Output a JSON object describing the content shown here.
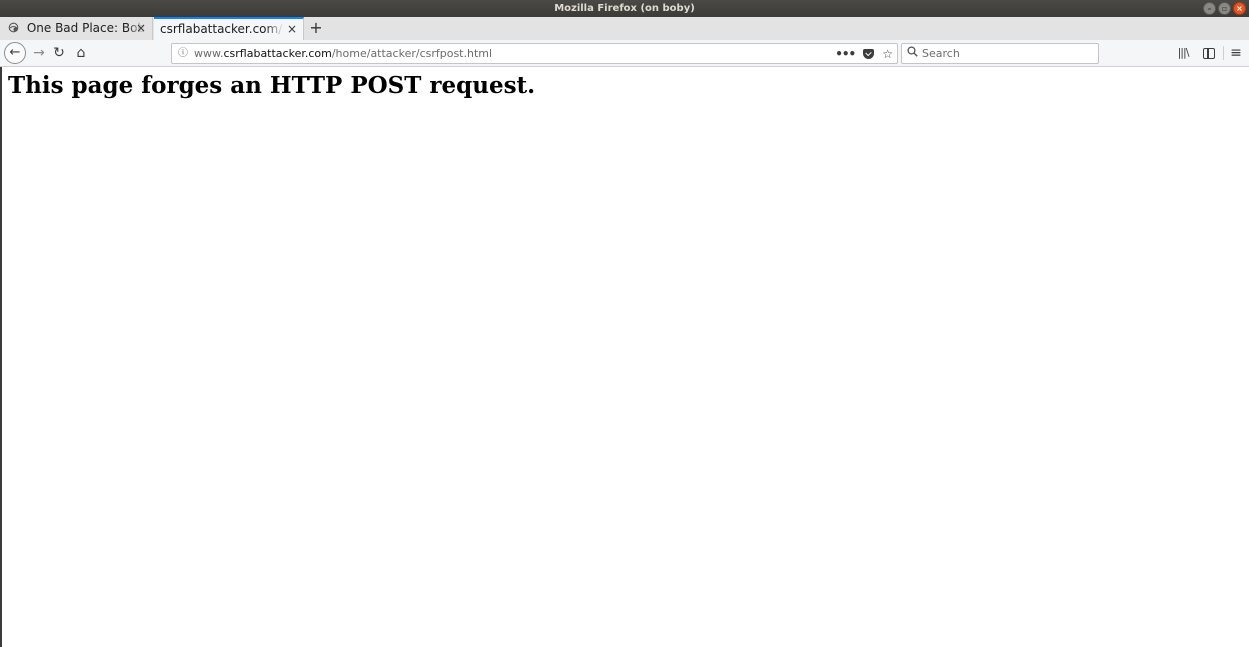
{
  "window": {
    "title": "Mozilla Firefox (on boby)"
  },
  "tabs": [
    {
      "label": "One Bad Place: Boby's",
      "active": false,
      "close_glyph": "×"
    },
    {
      "label": "csrflabattacker.com/home/",
      "active": true,
      "close_glyph": "×"
    }
  ],
  "new_tab_glyph": "+",
  "navigation": {
    "back_glyph": "←",
    "forward_glyph": "→",
    "reload_glyph": "↻",
    "home_glyph": "⌂"
  },
  "url_bar": {
    "info_glyph": "ⓘ",
    "prefix": "www.",
    "host": "csrflabattacker.com",
    "path": "/home/attacker/csrfpost.html",
    "more_glyph": "•••",
    "bookmark_glyph": "☆"
  },
  "search_bar": {
    "icon_glyph": "⚲",
    "placeholder": "Search",
    "value": ""
  },
  "toolbar_right": {
    "library_glyph": "|||\\",
    "menu_glyph": "≡"
  },
  "page": {
    "heading": "This page forges an HTTP POST request."
  },
  "icons": {
    "tab1": "site-favicon-icon",
    "info": "info-icon",
    "pocket": "pocket-icon",
    "bookmark": "bookmark-star-icon",
    "search": "search-icon",
    "library": "library-icon",
    "sidebar": "sidebar-icon",
    "menu": "hamburger-menu-icon"
  },
  "colors": {
    "active_tab_accent": "#0a84ff",
    "titlebar": "#3c3b37",
    "close_button": "#e95420"
  }
}
